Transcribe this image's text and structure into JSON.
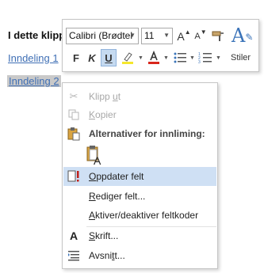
{
  "document": {
    "heading": "I dette klipp",
    "link1": "Inndeling 1",
    "link2": "Inndeling 2"
  },
  "toolbar": {
    "font_name": "Calibri (Brødtel",
    "font_size": "11",
    "grow_font": "A",
    "shrink_font": "A",
    "bold": "F",
    "italic": "K",
    "underline": "U",
    "font_color": "A",
    "styles_label": "Stiler",
    "colors": {
      "highlight": "#f5e72c",
      "font_color": "#d8261c",
      "accent": "#3b74b9"
    }
  },
  "context_menu": {
    "cut": {
      "pre": "Klipp ",
      "ul": "u",
      "post": "t",
      "icon": "scissors-icon"
    },
    "copy": {
      "pre": "",
      "ul": "K",
      "post": "opier",
      "icon": "copy-icon"
    },
    "paste_header": "Alternativer for innliming:",
    "paste_option_icon": "keep-text-only-icon",
    "update_field": {
      "pre": "",
      "ul": "O",
      "post": "ppdater felt",
      "icon": "update-field-icon"
    },
    "edit_field": {
      "pre": "",
      "ul": "R",
      "post": "ediger felt...",
      "icon": ""
    },
    "toggle_field_codes": {
      "pre": "",
      "ul": "A",
      "post": "ktiver/deaktiver feltkoder",
      "icon": ""
    },
    "font": {
      "pre": "",
      "ul": "S",
      "post": "krift...",
      "icon": "font-icon"
    },
    "paragraph": {
      "pre": "Avsni",
      "ul": "t",
      "post": "t...",
      "icon": "paragraph-icon"
    }
  }
}
